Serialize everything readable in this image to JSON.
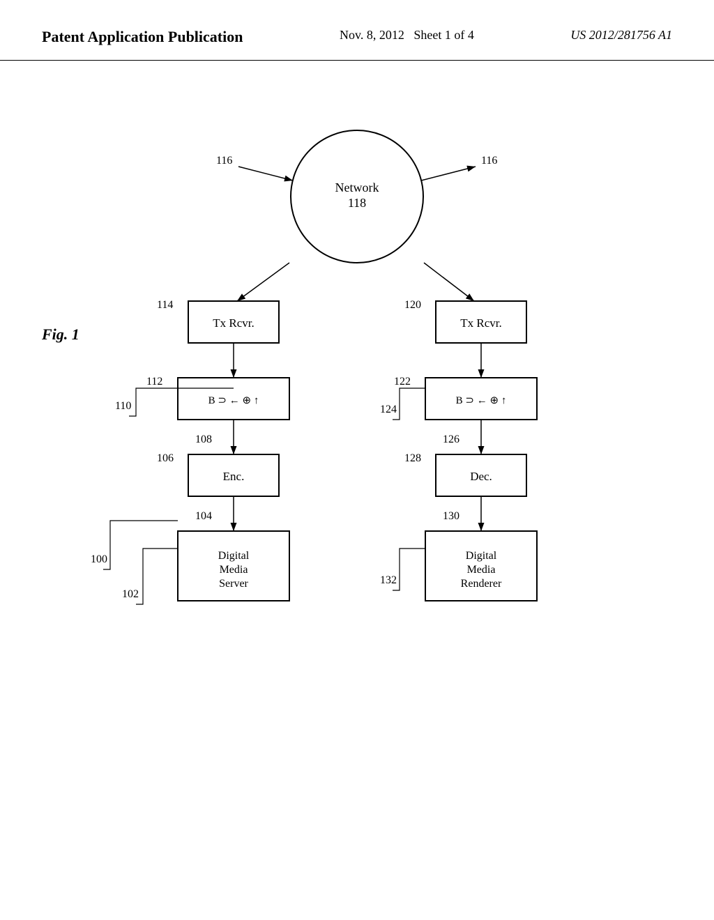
{
  "header": {
    "title": "Patent Application Publication",
    "date": "Nov. 8, 2012",
    "sheet": "Sheet 1 of 4",
    "patent_number": "US 2012/281756 A1"
  },
  "figure": {
    "label": "Fig. 1",
    "nodes": {
      "network": {
        "label": "Network\n118",
        "shape": "circle"
      },
      "tx_rcvr_left": {
        "label": "Tx Rcvr.",
        "ref": "114"
      },
      "tx_rcvr_right": {
        "label": "Tx Rcvr.",
        "ref": "120"
      },
      "codec_left": {
        "label": "B ⊃ ← ⊕ ↑",
        "ref": "112"
      },
      "codec_right": {
        "label": "B ⊃ ← ⊕ ↑",
        "ref": "122"
      },
      "enc": {
        "label": "Enc.",
        "ref": "106"
      },
      "dec": {
        "label": "Dec.",
        "ref": "128"
      },
      "dms": {
        "label": "Digital\nMedia\nServer",
        "ref": "102"
      },
      "dmr": {
        "label": "Digital\nMedia\nRenderer",
        "ref": "132"
      }
    },
    "ref_labels": {
      "r100": "100",
      "r104": "104",
      "r108": "108",
      "r110": "110",
      "r116_left": "116",
      "r116_right": "116",
      "r124": "124",
      "r126": "126",
      "r130": "130"
    }
  }
}
